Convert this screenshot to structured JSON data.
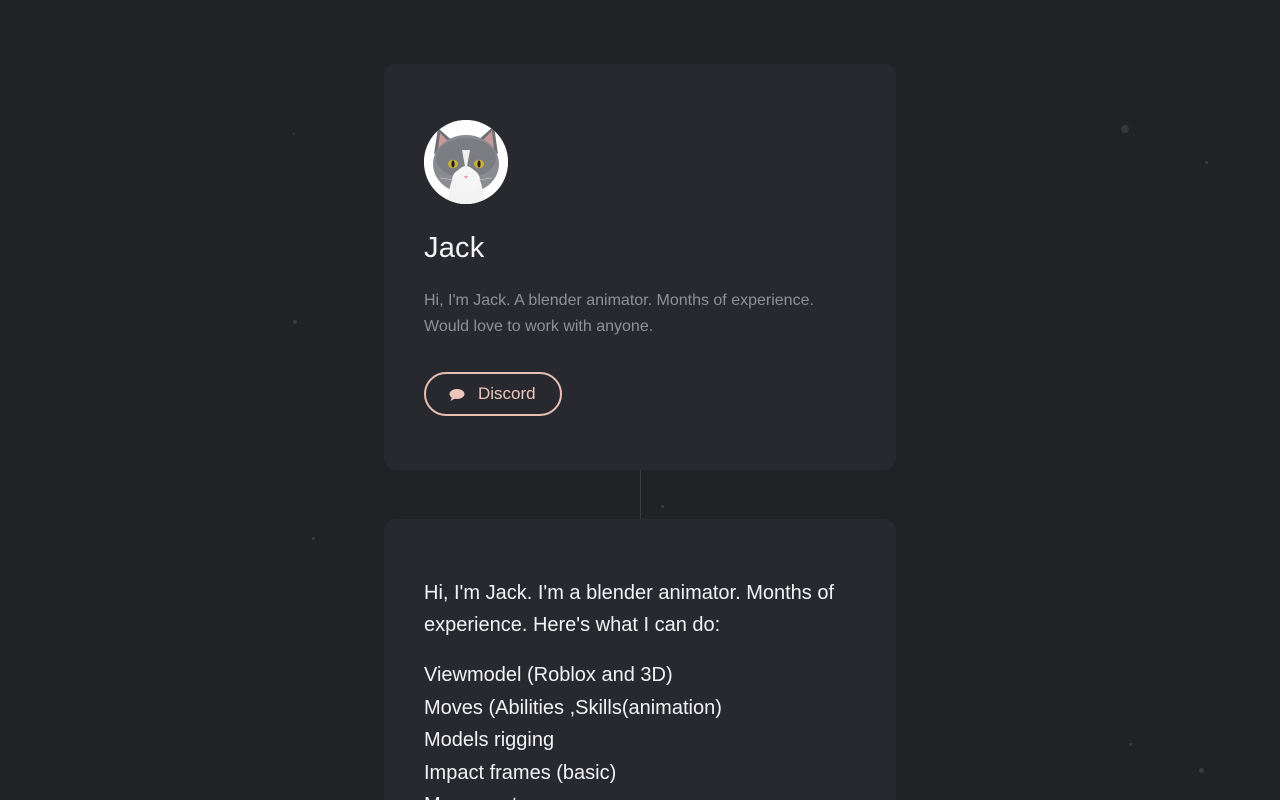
{
  "profile": {
    "avatar_alt": "Cat avatar",
    "name": "Jack",
    "bio_line1": "Hi, I'm Jack. A blender animator. Months of experience.",
    "bio_line2": "Would love to work with anyone.",
    "discord_label": "Discord",
    "discord_icon": "speech-bubble-icon"
  },
  "about": {
    "intro": "Hi, I'm Jack. I'm a blender animator. Months of experience. Here's what I can do:",
    "skills": [
      "Viewmodel (Roblox and 3D)",
      "Moves (Abilities ,Skills(animation)",
      "Models rigging",
      "Impact frames (basic)",
      "Movement"
    ]
  },
  "colors": {
    "background": "#212226",
    "card": "#28292f",
    "accent": "#e8bfb4",
    "text_primary": "#f4f4f6",
    "text_muted": "#8f9098"
  }
}
